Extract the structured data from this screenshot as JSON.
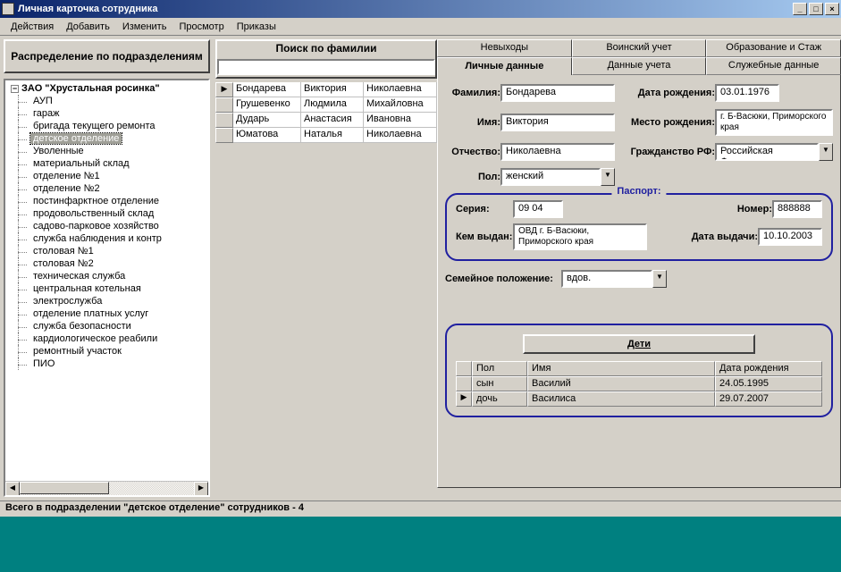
{
  "window": {
    "title": "Личная карточка сотрудника",
    "min": "_",
    "max": "□",
    "close": "×"
  },
  "menu": {
    "actions": "Действия",
    "add": "Добавить",
    "edit": "Изменить",
    "view": "Просмотр",
    "orders": "Приказы"
  },
  "left": {
    "header": "Распределение по подразделениям",
    "root": "ЗАО \"Хрустальная росинка\"",
    "selected_index": 3,
    "items": [
      "АУП",
      "гараж",
      "бригада текущего ремонта",
      "детское отделение",
      "Уволенные",
      "материальный склад",
      "отделение №1",
      "отделение №2",
      "постинфарктное отделение",
      "продовольственный склад",
      "садово-парковое хозяйство",
      "служба наблюдения и контр",
      "столовая №1",
      "столовая №2",
      "техническая служба",
      "центральная котельная",
      "электрослужба",
      "отделение платных услуг",
      "служба безопасности",
      "кардиологическое реабили",
      "ремонтный участок",
      "ПИО"
    ]
  },
  "search": {
    "header": "Поиск по фамилии",
    "value": "",
    "results": [
      {
        "a": "Бондарева",
        "b": "Виктория",
        "c": "Николаевна"
      },
      {
        "a": "Грушевенко",
        "b": "Людмила",
        "c": "Михайловна"
      },
      {
        "a": "Дударь",
        "b": "Анастасия",
        "c": "Ивановна"
      },
      {
        "a": "Юматова",
        "b": "Наталья",
        "c": "Николаевна"
      }
    ]
  },
  "tabs": {
    "row1": [
      "Невыходы",
      "Воинский учет",
      "Образование и Стаж"
    ],
    "row2": [
      "Личные данные",
      "Данные учета",
      "Служебные данные"
    ],
    "active": "Личные данные"
  },
  "form": {
    "surname_lbl": "Фамилия:",
    "surname": "Бондарева",
    "dob_lbl": "Дата рождения:",
    "dob": "03.01.1976",
    "name_lbl": "Имя:",
    "name": "Виктория",
    "pob_lbl": "Место рождения:",
    "pob": "г. Б-Васюки, Приморского края",
    "patr_lbl": "Отчество:",
    "patr": "Николаевна",
    "cit_lbl": "Гражданство РФ:",
    "cit": "Российская Федерация",
    "sex_lbl": "Пол:",
    "sex": "женский",
    "passport_title": "Паспорт:",
    "series_lbl": "Серия:",
    "series": "09 04",
    "number_lbl": "Номер:",
    "number": "888888",
    "issued_lbl": "Кем выдан:",
    "issued": "ОВД г. Б-Васюки, Приморского края",
    "idate_lbl": "Дата выдачи:",
    "idate": "10.10.2003",
    "marital_lbl": "Семейное положение:",
    "marital": "вдов.",
    "kids_btn": "Дети",
    "kids_head": {
      "sex": "Пол",
      "name": "Имя",
      "dob": "Дата рождения"
    },
    "kids": [
      {
        "sex": "сын",
        "name": "Василий",
        "dob": "24.05.1995"
      },
      {
        "sex": "дочь",
        "name": "Василиса",
        "dob": "29.07.2007"
      }
    ]
  },
  "status": "Всего в подразделении \"детское отделение\" сотрудников - 4",
  "glyphs": {
    "tri_right": "▶",
    "tri_left": "◀",
    "tri_down": "▼",
    "minus": "−"
  }
}
